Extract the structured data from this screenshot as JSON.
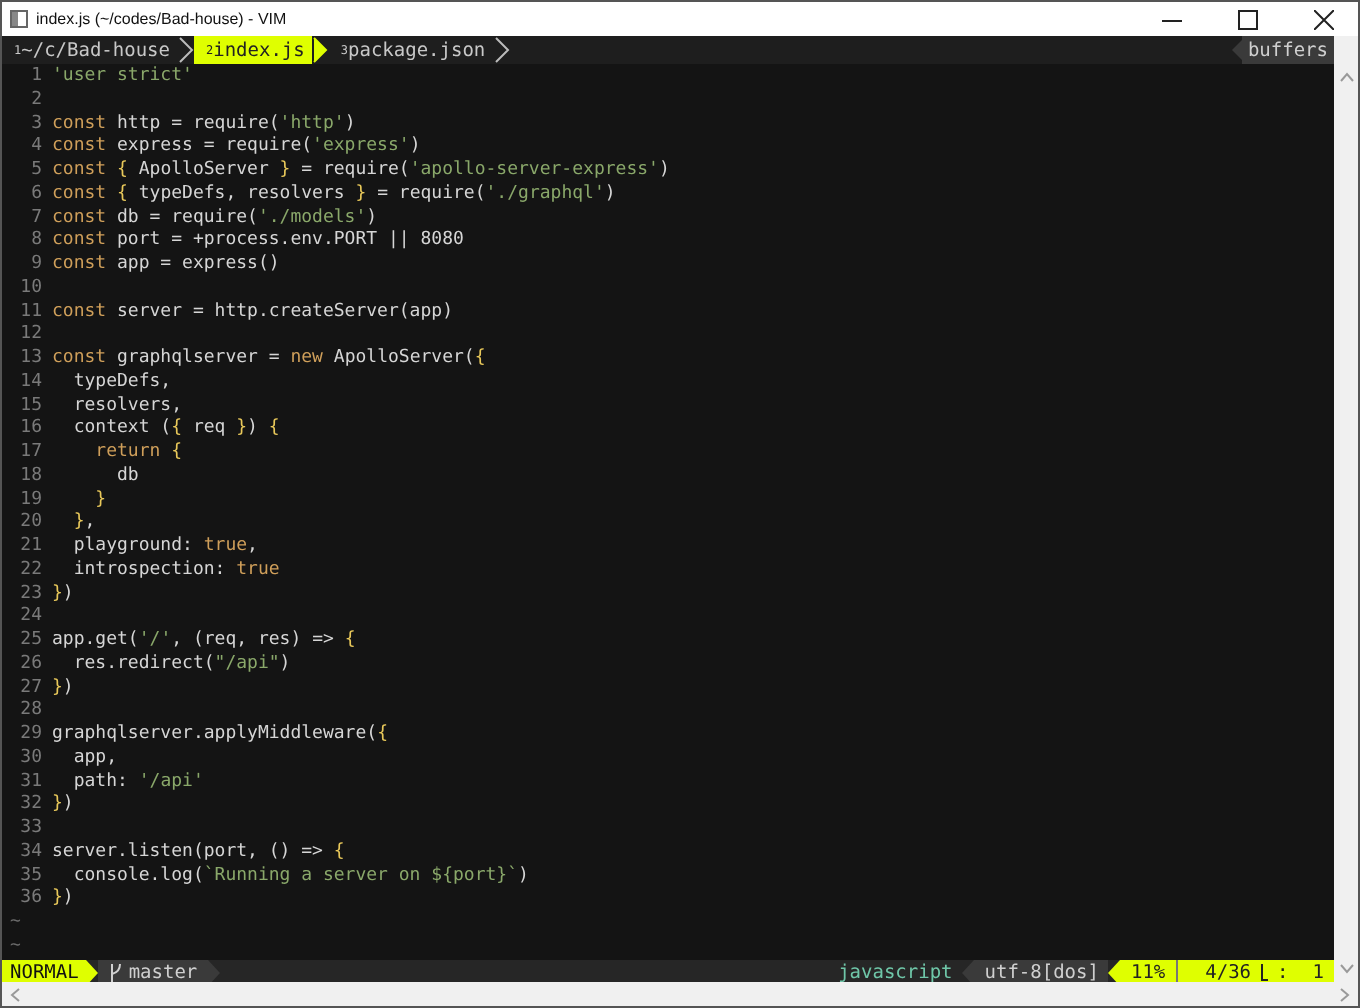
{
  "window": {
    "title": "index.js (~/codes/Bad-house) - VIM"
  },
  "tabs": [
    {
      "label": "$^{1}$~/c/Bad-house",
      "selected": false
    },
    {
      "label": "$^{2}$index.js",
      "selected": true
    },
    {
      "label": "$^{3}$package.json",
      "selected": false
    }
  ],
  "buffers_label": "buffers",
  "code": [
    {
      "number": "1",
      "tokens": [
        {
          "kind": "s",
          "text": "'user strict'"
        }
      ]
    },
    {
      "number": "2"
    },
    {
      "number": "3",
      "tokens": [
        {
          "kind": "k",
          "text": "const"
        },
        {
          "kind": "p",
          "text": " http = require("
        },
        {
          "kind": "s",
          "text": "'http'"
        },
        {
          "kind": "p",
          "text": ")"
        }
      ]
    },
    {
      "number": "4",
      "tokens": [
        {
          "kind": "k",
          "text": "const"
        },
        {
          "kind": "p",
          "text": " express = require("
        },
        {
          "kind": "s",
          "text": "'express'"
        },
        {
          "kind": "p",
          "text": ")"
        }
      ]
    },
    {
      "number": "5",
      "tokens": [
        {
          "kind": "k",
          "text": "const"
        },
        {
          "kind": "b",
          "text": " {"
        },
        {
          "kind": "p",
          "text": " ApolloServer "
        },
        {
          "kind": "b",
          "text": "}"
        },
        {
          "kind": "p",
          "text": " = require("
        },
        {
          "kind": "s",
          "text": "'apollo-server-express'"
        },
        {
          "kind": "p",
          "text": ")"
        }
      ]
    },
    {
      "number": "6",
      "tokens": [
        {
          "kind": "k",
          "text": "const"
        },
        {
          "kind": "b",
          "text": " {"
        },
        {
          "kind": "p",
          "text": " typeDefs, resolvers "
        },
        {
          "kind": "b",
          "text": "}"
        },
        {
          "kind": "p",
          "text": " = require("
        },
        {
          "kind": "s",
          "text": "'./graphql'"
        },
        {
          "kind": "p",
          "text": ")"
        }
      ]
    },
    {
      "number": "7",
      "tokens": [
        {
          "kind": "k",
          "text": "const"
        },
        {
          "kind": "p",
          "text": " db = require("
        },
        {
          "kind": "s",
          "text": "'./models'"
        },
        {
          "kind": "p",
          "text": ")"
        }
      ]
    },
    {
      "number": "8",
      "tokens": [
        {
          "kind": "k",
          "text": "const"
        },
        {
          "kind": "p",
          "text": " port = +process.env.PORT || 8080"
        }
      ]
    },
    {
      "number": "9",
      "tokens": [
        {
          "kind": "k",
          "text": "const"
        },
        {
          "kind": "p",
          "text": " app = express()"
        }
      ]
    },
    {
      "number": "10"
    },
    {
      "number": "11",
      "tokens": [
        {
          "kind": "k",
          "text": "const"
        },
        {
          "kind": "p",
          "text": " server = http.createServer(app)"
        }
      ]
    },
    {
      "number": "12"
    },
    {
      "number": "13",
      "tokens": [
        {
          "kind": "k",
          "text": "const"
        },
        {
          "kind": "p",
          "text": " graphqlserver = "
        },
        {
          "kind": "k",
          "text": "new"
        },
        {
          "kind": "p",
          "text": " ApolloServer("
        },
        {
          "kind": "b",
          "text": "{"
        }
      ]
    },
    {
      "number": "14",
      "tokens": [
        {
          "kind": "p",
          "text": "  typeDefs,"
        }
      ]
    },
    {
      "number": "15",
      "tokens": [
        {
          "kind": "p",
          "text": "  resolvers,"
        }
      ]
    },
    {
      "number": "16",
      "tokens": [
        {
          "kind": "p",
          "text": "  context ("
        },
        {
          "kind": "b",
          "text": "{"
        },
        {
          "kind": "p",
          "text": " req "
        },
        {
          "kind": "b",
          "text": "}"
        },
        {
          "kind": "p",
          "text": ") "
        },
        {
          "kind": "b",
          "text": "{"
        }
      ]
    },
    {
      "number": "17",
      "tokens": [
        {
          "kind": "k",
          "text": "    return"
        },
        {
          "kind": "b",
          "text": " {"
        }
      ]
    },
    {
      "number": "18",
      "tokens": [
        {
          "kind": "p",
          "text": "      db"
        }
      ]
    },
    {
      "number": "19",
      "tokens": [
        {
          "kind": "b",
          "text": "    }"
        }
      ]
    },
    {
      "number": "20",
      "tokens": [
        {
          "kind": "b",
          "text": "  }"
        },
        {
          "kind": "p",
          "text": ","
        }
      ]
    },
    {
      "number": "21",
      "tokens": [
        {
          "kind": "p",
          "text": "  playground: "
        },
        {
          "kind": "k",
          "text": "true"
        },
        {
          "kind": "p",
          "text": ","
        }
      ]
    },
    {
      "number": "22",
      "tokens": [
        {
          "kind": "p",
          "text": "  introspection: "
        },
        {
          "kind": "k",
          "text": "true"
        }
      ]
    },
    {
      "number": "23",
      "tokens": [
        {
          "kind": "b",
          "text": "}"
        },
        {
          "kind": "p",
          "text": ")"
        }
      ]
    },
    {
      "number": "24"
    },
    {
      "number": "25",
      "tokens": [
        {
          "kind": "p",
          "text": "app.get("
        },
        {
          "kind": "s",
          "text": "'/'"
        },
        {
          "kind": "p",
          "text": ", (req, res) => "
        },
        {
          "kind": "b",
          "text": "{"
        }
      ]
    },
    {
      "number": "26",
      "tokens": [
        {
          "kind": "p",
          "text": "  res.redirect("
        },
        {
          "kind": "s",
          "text": "\"/api\""
        },
        {
          "kind": "p",
          "text": ")"
        }
      ]
    },
    {
      "number": "27",
      "tokens": [
        {
          "kind": "b",
          "text": "}"
        },
        {
          "kind": "p",
          "text": ")"
        }
      ]
    },
    {
      "number": "28"
    },
    {
      "number": "29",
      "tokens": [
        {
          "kind": "p",
          "text": "graphqlserver.applyMiddleware("
        },
        {
          "kind": "b",
          "text": "{"
        }
      ]
    },
    {
      "number": "30",
      "tokens": [
        {
          "kind": "p",
          "text": "  app,"
        }
      ]
    },
    {
      "number": "31",
      "tokens": [
        {
          "kind": "p",
          "text": "  path: "
        },
        {
          "kind": "s",
          "text": "'/api'"
        }
      ]
    },
    {
      "number": "32",
      "tokens": [
        {
          "kind": "b",
          "text": "}"
        },
        {
          "kind": "p",
          "text": ")"
        }
      ]
    },
    {
      "number": "33"
    },
    {
      "number": "34",
      "tokens": [
        {
          "kind": "p",
          "text": "server.listen(port, () => "
        },
        {
          "kind": "b",
          "text": "{"
        }
      ]
    },
    {
      "number": "35",
      "tokens": [
        {
          "kind": "p",
          "text": "  console.log("
        },
        {
          "kind": "s",
          "text": "`Running a server on ${port}`"
        },
        {
          "kind": "p",
          "text": ")"
        }
      ]
    },
    {
      "number": "36",
      "tokens": [
        {
          "kind": "b",
          "text": "}"
        },
        {
          "kind": "p",
          "text": ")"
        }
      ]
    }
  ],
  "filler_lines": [
    "~",
    "~"
  ],
  "status_bar": {
    "mode": "NORMAL",
    "branch": "master",
    "filetype": "javascript",
    "encoding": "utf-8[dos]",
    "percent": "11%",
    "line": "4/36",
    "column_separator": ":",
    "column": "1"
  }
}
